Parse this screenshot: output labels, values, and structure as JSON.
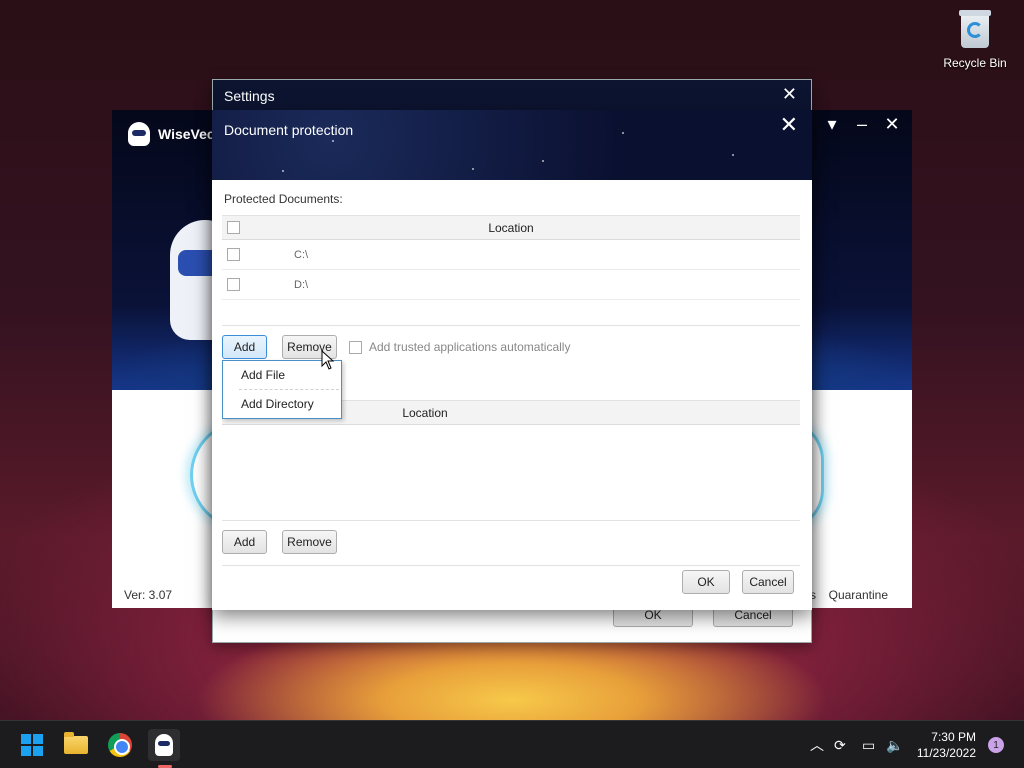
{
  "desktop": {
    "recycle_bin_label": "Recycle Bin"
  },
  "app": {
    "name": "WiseVec",
    "version": "Ver: 3.07",
    "quarantine": "Quarantine",
    "s_fragment": "s"
  },
  "settings": {
    "title": "Settings",
    "ok": "OK",
    "cancel": "Cancel"
  },
  "dialog": {
    "title": "Document protection",
    "protected_label": "Protected Documents:",
    "top_table": {
      "column": "Location",
      "rows": [
        {
          "path": "C:\\"
        },
        {
          "path": "D:\\"
        }
      ]
    },
    "add": "Add",
    "remove": "Remove",
    "trusted_checkbox": "Add trusted applications automatically",
    "menu": {
      "items": [
        "Add File",
        "Add Directory"
      ]
    },
    "bottom_table": {
      "column": "Location"
    },
    "add2": "Add",
    "remove2": "Remove",
    "ok": "OK",
    "cancel": "Cancel"
  },
  "taskbar": {
    "time": "7:30 PM",
    "date": "11/23/2022",
    "notifications": "1"
  }
}
